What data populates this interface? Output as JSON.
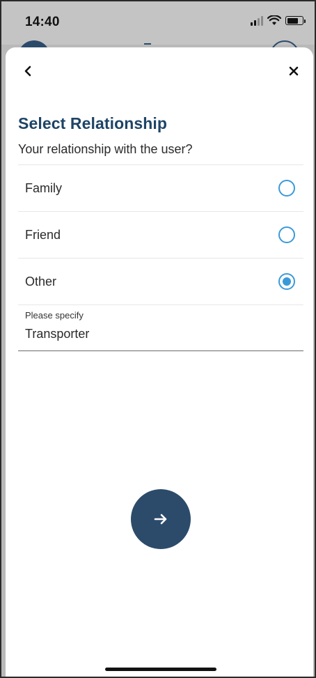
{
  "status_bar": {
    "time": "14:40",
    "icons": [
      "signal-icon",
      "wifi-icon",
      "battery-icon"
    ]
  },
  "sheet": {
    "title": "Select Relationship",
    "subtitle": "Your relationship with the user?",
    "back_icon": "chevron-left-icon",
    "close_icon": "close-icon",
    "options": [
      {
        "label": "Family",
        "selected": false
      },
      {
        "label": "Friend",
        "selected": false
      },
      {
        "label": "Other",
        "selected": true
      }
    ],
    "specify": {
      "label": "Please specify",
      "value": "Transporter"
    },
    "next_icon": "arrow-right-icon"
  },
  "colors": {
    "primary": "#2c4b6b",
    "title": "#1e4466",
    "radio_accent": "#3a9ad9"
  }
}
